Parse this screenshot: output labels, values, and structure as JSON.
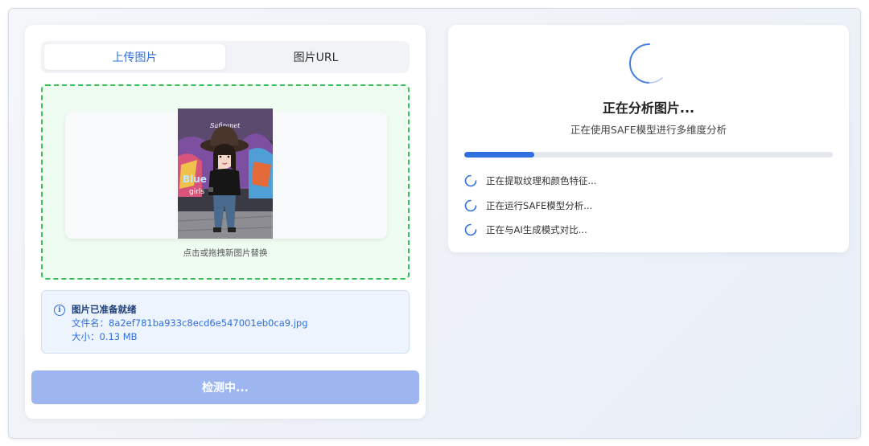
{
  "tabs": [
    {
      "label": "上传图片",
      "active": true
    },
    {
      "label": "图片URL",
      "active": false
    }
  ],
  "dropzone": {
    "hint": "点击或拖拽新图片替换"
  },
  "file_info": {
    "title": "图片已准备就绪",
    "filename_line": "文件名：8a2ef781ba933c8ecd6e547001eb0ca9.jpg",
    "size_line": "大小：0.13 MB"
  },
  "detect_button": {
    "label": "检测中..."
  },
  "analysis": {
    "title": "正在分析图片...",
    "subtitle": "正在使用SAFE模型进行多维度分析",
    "progress_percent": 19,
    "steps": [
      {
        "label": "正在提取纹理和颜色特征...",
        "icon": "spinner-icon"
      },
      {
        "label": "正在运行SAFE模型分析...",
        "icon": "spinner-icon"
      },
      {
        "label": "正在与AI生成模式对比...",
        "icon": "spinner-icon"
      }
    ]
  },
  "colors": {
    "accent": "#2f6fe0",
    "dropzone_border": "#3bbf5a",
    "button_disabled": "#9db6f0"
  }
}
